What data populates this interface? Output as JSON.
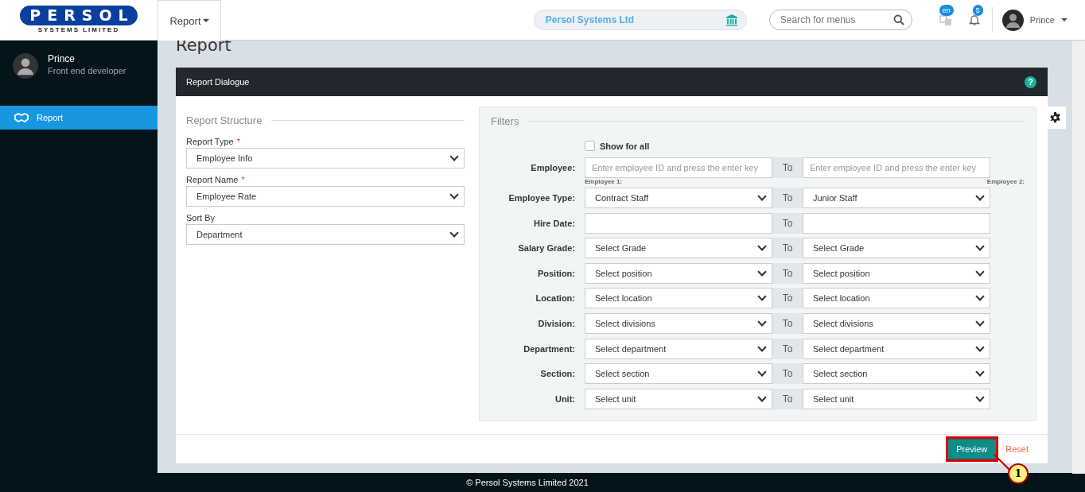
{
  "logo": {
    "text": "PERSOL",
    "subtitle": "SYSTEMS LIMITED"
  },
  "top_menu": {
    "label": "Report"
  },
  "company": {
    "name": "Persol Systems Ltd"
  },
  "search": {
    "placeholder": "Search for menus"
  },
  "language_badge": "en",
  "notification_badge": "5",
  "user_menu": {
    "name": "Prince"
  },
  "sidebar": {
    "user": {
      "name": "Prince",
      "role": "Front end developer"
    },
    "items": [
      {
        "label": "Report",
        "selected": true
      }
    ]
  },
  "page_title": "Report",
  "dialog": {
    "title": "Report Dialogue",
    "help": "?",
    "structure": {
      "legend": "Report Structure",
      "fields": [
        {
          "label": "Report Type",
          "required_mark": "*",
          "value": "Employee Info"
        },
        {
          "label": "Report Name",
          "required_mark": "*",
          "value": "Employee Rate"
        },
        {
          "label": "Sort By",
          "value": "Department"
        }
      ]
    },
    "filters": {
      "legend": "Filters",
      "show_for_all": {
        "label": "Show for all",
        "checked": false
      },
      "rows": [
        {
          "label": "Employee:",
          "kind": "text",
          "to_label": "To",
          "from": {
            "placeholder": "Enter employee ID and press the enter key"
          },
          "to": {
            "placeholder": "Enter employee ID and press the enter key"
          },
          "from_caption": "Employee 1:",
          "to_caption": "Employee 2:"
        },
        {
          "label": "Employee Type:",
          "kind": "select",
          "to_label": "To",
          "from": {
            "value": "Contract Staff"
          },
          "to": {
            "value": "Junior Staff"
          }
        },
        {
          "label": "Hire Date:",
          "kind": "date",
          "to_label": "To",
          "from": {},
          "to": {}
        },
        {
          "label": "Salary Grade:",
          "kind": "select",
          "to_label": "To",
          "from": {
            "value": "Select Grade"
          },
          "to": {
            "value": "Select Grade"
          }
        },
        {
          "label": "Position:",
          "kind": "select",
          "to_label": "To",
          "from": {
            "value": "Select position"
          },
          "to": {
            "value": "Select position"
          }
        },
        {
          "label": "Location:",
          "kind": "select",
          "to_label": "To",
          "from": {
            "value": "Select location"
          },
          "to": {
            "value": "Select location"
          }
        },
        {
          "label": "Division:",
          "kind": "select",
          "to_label": "To",
          "from": {
            "value": "Select divisions"
          },
          "to": {
            "value": "Select divisions"
          }
        },
        {
          "label": "Department:",
          "kind": "select",
          "to_label": "To",
          "from": {
            "value": "Select department"
          },
          "to": {
            "value": "Select department"
          }
        },
        {
          "label": "Section:",
          "kind": "select",
          "to_label": "To",
          "from": {
            "value": "Select section"
          },
          "to": {
            "value": "Select section"
          }
        },
        {
          "label": "Unit:",
          "kind": "select",
          "to_label": "To",
          "from": {
            "value": "Select unit"
          },
          "to": {
            "value": "Select unit"
          }
        }
      ]
    },
    "buttons": {
      "preview": "Preview",
      "reset": "Reset"
    }
  },
  "callout": {
    "number": "1"
  },
  "footer": "© Persol Systems Limited 2021"
}
